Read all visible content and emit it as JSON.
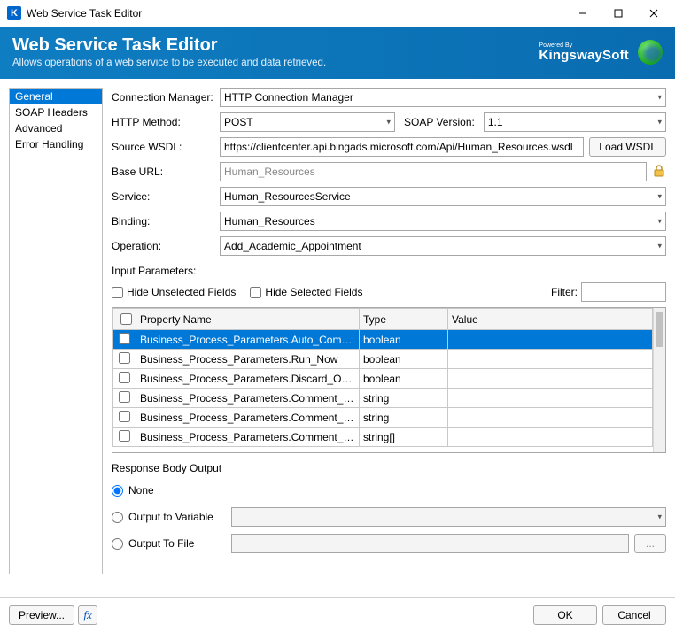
{
  "window": {
    "title": "Web Service Task Editor",
    "app_icon_glyph": "K"
  },
  "banner": {
    "heading": "Web Service Task Editor",
    "subtitle": "Allows operations of a web service to be executed and data retrieved.",
    "powered_by": "Powered By",
    "brand": "KingswaySoft"
  },
  "sidebar": {
    "items": [
      "General",
      "SOAP Headers",
      "Advanced",
      "Error Handling"
    ],
    "selected_index": 0
  },
  "form": {
    "connection_manager_label": "Connection Manager:",
    "connection_manager_value": "HTTP Connection Manager",
    "http_method_label": "HTTP Method:",
    "http_method_value": "POST",
    "soap_version_label": "SOAP Version:",
    "soap_version_value": "1.1",
    "source_wsdl_label": "Source WSDL:",
    "source_wsdl_value": "https://clientcenter.api.bingads.microsoft.com/Api/Human_Resources.wsdl",
    "load_wsdl_button": "Load WSDL",
    "base_url_label": "Base URL:",
    "base_url_value": "Human_Resources",
    "service_label": "Service:",
    "service_value": "Human_ResourcesService",
    "binding_label": "Binding:",
    "binding_value": "Human_Resources",
    "operation_label": "Operation:",
    "operation_value": "Add_Academic_Appointment",
    "input_parameters_label": "Input Parameters:",
    "hide_unselected_label": "Hide Unselected Fields",
    "hide_selected_label": "Hide Selected Fields",
    "filter_label": "Filter:"
  },
  "table": {
    "headers": {
      "property": "Property Name",
      "type": "Type",
      "value": "Value"
    },
    "rows": [
      {
        "checked": false,
        "name": "Business_Process_Parameters.Auto_Complete",
        "type": "boolean",
        "value": "",
        "selected": true
      },
      {
        "checked": false,
        "name": "Business_Process_Parameters.Run_Now",
        "type": "boolean",
        "value": ""
      },
      {
        "checked": false,
        "name": "Business_Process_Parameters.Discard_On_E...",
        "type": "boolean",
        "value": ""
      },
      {
        "checked": false,
        "name": "Business_Process_Parameters.Comment_Dat...",
        "type": "string",
        "value": ""
      },
      {
        "checked": false,
        "name": "Business_Process_Parameters.Comment_Dat...",
        "type": "string",
        "value": ""
      },
      {
        "checked": false,
        "name": "Business_Process_Parameters.Comment_Dat...",
        "type": "string[]",
        "value": ""
      }
    ]
  },
  "response": {
    "heading": "Response Body Output",
    "none_label": "None",
    "variable_label": "Output to Variable",
    "file_label": "Output To File",
    "browse_button": "...",
    "selected": "none"
  },
  "footer": {
    "preview": "Preview...",
    "ok": "OK",
    "cancel": "Cancel",
    "fx_glyph": "fx"
  }
}
